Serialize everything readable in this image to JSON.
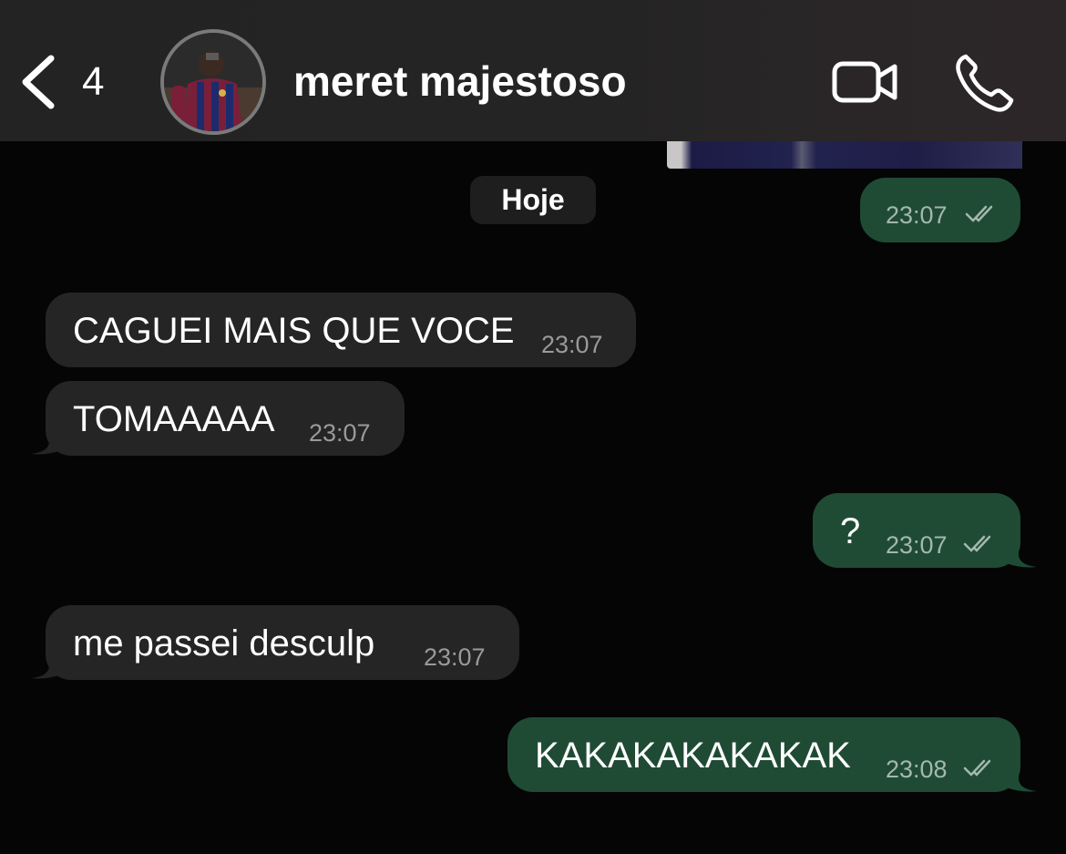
{
  "header": {
    "unread_count": "4",
    "contact_name": "meret majestoso",
    "icons": {
      "back": "chevron-left-icon",
      "video": "video-camera-icon",
      "voice": "phone-icon"
    }
  },
  "date_separator": "Hoje",
  "messages": [
    {
      "direction": "out",
      "text": "",
      "time": "23:07",
      "status": "read"
    },
    {
      "direction": "in",
      "text": "CAGUEI MAIS QUE VOCE",
      "time": "23:07"
    },
    {
      "direction": "in",
      "text": "TOMAAAAA",
      "time": "23:07"
    },
    {
      "direction": "out",
      "text": "?",
      "time": "23:07",
      "status": "read"
    },
    {
      "direction": "in",
      "text": "me passei desculp",
      "time": "23:07"
    },
    {
      "direction": "out",
      "text": "KAKAKAKAKAKAK",
      "time": "23:08",
      "status": "read"
    }
  ],
  "colors": {
    "incoming_bubble": "#252525",
    "outgoing_bubble": "#1f4b35",
    "header_bg": "#232323",
    "background": "#050505"
  }
}
